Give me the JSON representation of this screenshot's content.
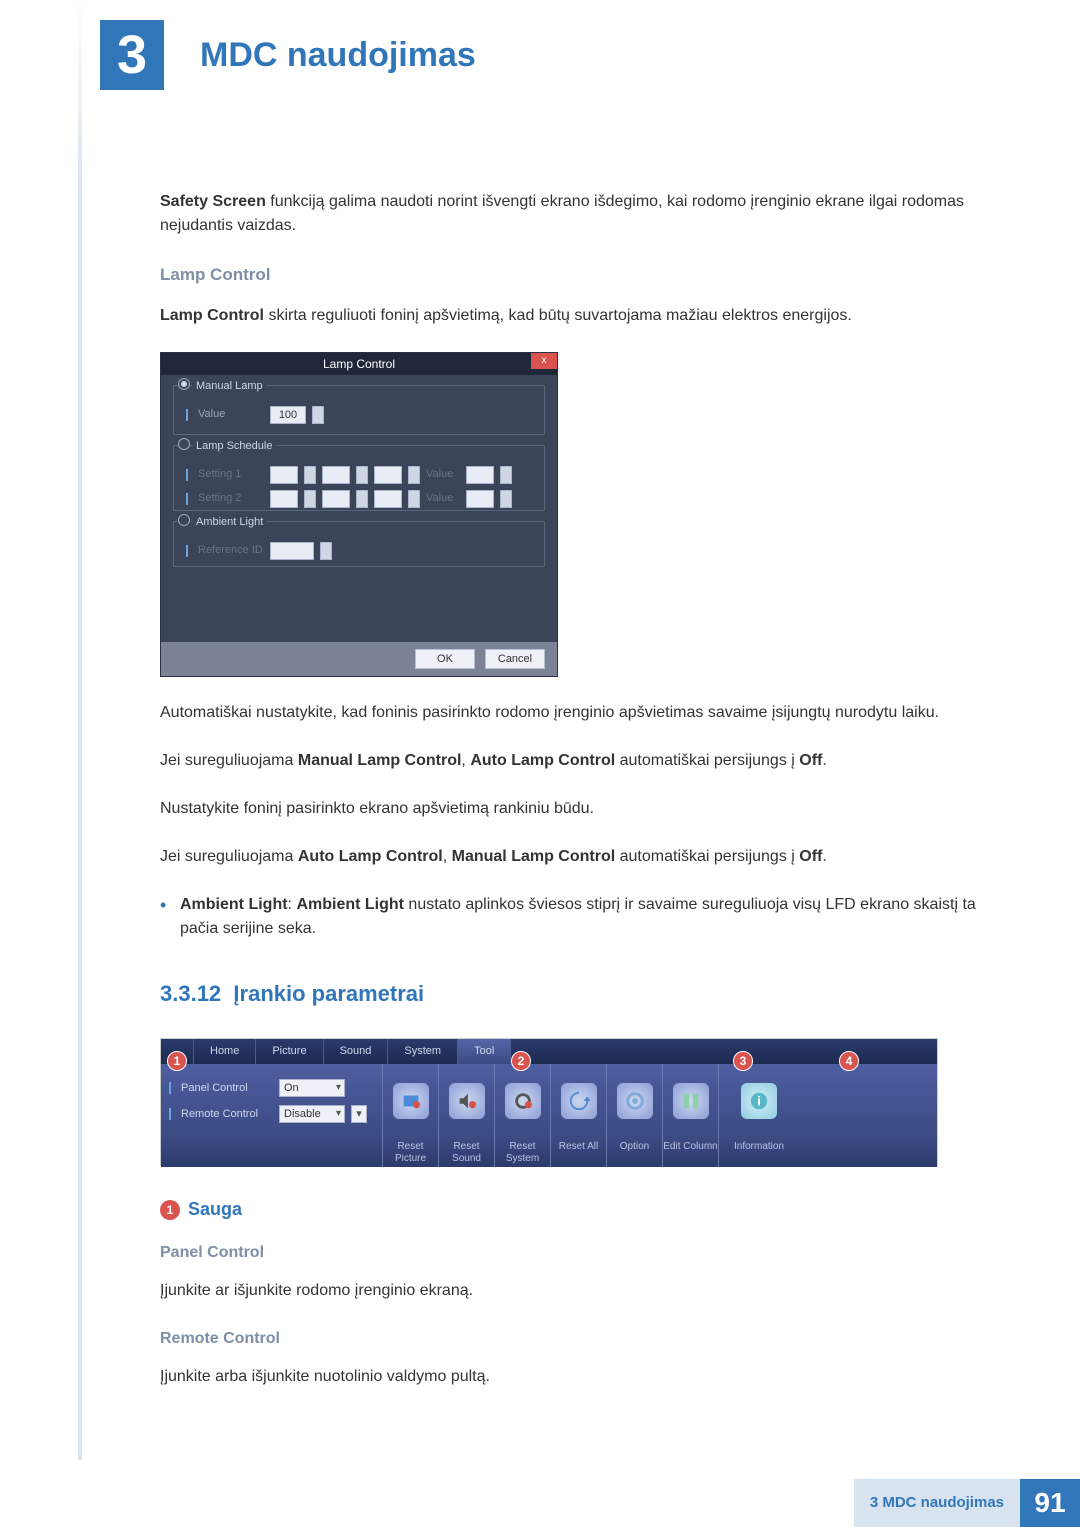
{
  "chapter": {
    "number": "3",
    "title": "MDC naudojimas"
  },
  "intro": {
    "safety_screen_bold": "Safety Screen",
    "safety_screen_text": " funkciją galima naudoti norint išvengti ekrano išdegimo, kai rodomo įrenginio ekrane ilgai rodomas nejudantis vaizdas."
  },
  "lamp_control": {
    "heading": "Lamp Control",
    "desc_bold": "Lamp Control",
    "desc_text": " skirta reguliuoti foninį apšvietimą, kad būtų suvartojama mažiau elektros energijos.",
    "dialog": {
      "title": "Lamp Control",
      "close": "x",
      "manual_lamp": {
        "legend": "Manual Lamp",
        "value_label": "Value",
        "value": "100"
      },
      "lamp_schedule": {
        "legend": "Lamp Schedule",
        "setting1_label": "Setting 1",
        "setting2_label": "Setting 2",
        "value_label": "Value"
      },
      "ambient_light": {
        "legend": "Ambient Light",
        "ref_label": "Reference ID"
      },
      "ok": "OK",
      "cancel": "Cancel"
    },
    "p_auto": "Automatiškai nustatykite, kad foninis pasirinkto rodomo įrenginio apšvietimas savaime įsijungtų nurodytu laiku.",
    "p_manual_1a": "Jei sureguliuojama ",
    "p_manual_1b": "Manual Lamp Control",
    "p_manual_1c": ", ",
    "p_manual_1d": "Auto Lamp Control",
    "p_manual_1e": " automatiškai persijungs į ",
    "p_manual_1f": "Off",
    "p_manual_1g": ".",
    "p_set_bg": "Nustatykite foninį pasirinkto ekrano apšvietimą rankiniu būdu.",
    "p_auto_2a": "Jei sureguliuojama ",
    "p_auto_2b": "Auto Lamp Control",
    "p_auto_2c": ", ",
    "p_auto_2d": "Manual Lamp Control",
    "p_auto_2e": " automatiškai persijungs į ",
    "p_auto_2f": "Off",
    "p_auto_2g": ".",
    "bullet_bold1": "Ambient Light",
    "bullet_sep": ": ",
    "bullet_bold2": "Ambient Light",
    "bullet_rest": " nustato aplinkos šviesos stiprį ir savaime sureguliuoja visų LFD ekrano skaistį ta pačia serijine seka."
  },
  "section": {
    "num": "3.3.12",
    "title": "Įrankio parametrai"
  },
  "ribbon": {
    "tabs": [
      "Home",
      "Picture",
      "Sound",
      "System",
      "Tool"
    ],
    "panel_control_label": "Panel Control",
    "panel_control_value": "On",
    "remote_control_label": "Remote Control",
    "remote_control_value": "Disable",
    "labels": [
      "Reset Picture",
      "Reset Sound",
      "Reset System",
      "Reset All",
      "Option",
      "Edit Column",
      "Information"
    ],
    "badges": [
      "1",
      "2",
      "3",
      "4"
    ]
  },
  "sauga": {
    "num": "1",
    "title": "Sauga",
    "panel_h": "Panel Control",
    "panel_p": "Įjunkite ar išjunkite rodomo įrenginio ekraną.",
    "remote_h": "Remote Control",
    "remote_p": "Įjunkite arba išjunkite nuotolinio valdymo pultą."
  },
  "footer": {
    "text": "3 MDC naudojimas",
    "page": "91"
  }
}
